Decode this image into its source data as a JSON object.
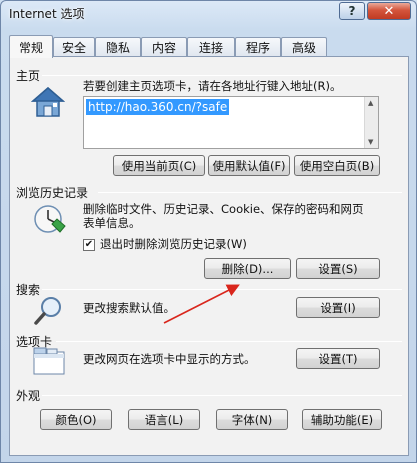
{
  "window": {
    "title": "Internet 选项",
    "help_label": "?",
    "close_label": "✕"
  },
  "tabs": [
    {
      "label": "常规",
      "active": true
    },
    {
      "label": "安全"
    },
    {
      "label": "隐私"
    },
    {
      "label": "内容"
    },
    {
      "label": "连接"
    },
    {
      "label": "程序"
    },
    {
      "label": "高级"
    }
  ],
  "home": {
    "label": "主页",
    "description": "若要创建主页选项卡，请在各地址行键入地址(R)。",
    "url": "http://hao.360.cn/?safe",
    "buttons": {
      "current": "使用当前页(C)",
      "default": "使用默认值(F)",
      "blank": "使用空白页(B)"
    }
  },
  "history": {
    "label": "浏览历史记录",
    "description_line1": "删除临时文件、历史记录、Cookie、保存的密码和网页",
    "description_line2": "表单信息。",
    "checkbox_label": "退出时删除浏览历史记录(W)",
    "checkbox_checked": true,
    "delete_button": "删除(D)...",
    "settings_button": "设置(S)"
  },
  "search": {
    "label": "搜索",
    "description": "更改搜索默认值。",
    "settings_button": "设置(I)"
  },
  "tabs_section": {
    "label": "选项卡",
    "description": "更改网页在选项卡中显示的方式。",
    "settings_button": "设置(T)"
  },
  "appearance": {
    "label": "外观",
    "buttons": {
      "colors": "颜色(O)",
      "languages": "语言(L)",
      "fonts": "字体(N)",
      "accessibility": "辅助功能(E)"
    }
  },
  "colors": {
    "accent": "#3399ff",
    "arrow": "#d9261c",
    "close": "#c03a22"
  }
}
